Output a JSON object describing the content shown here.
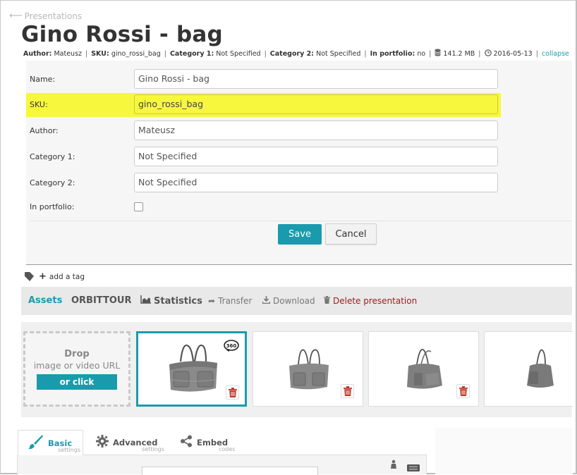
{
  "header": {
    "back_label": "Presentations",
    "title": "Gino Rossi - bag"
  },
  "meta": {
    "author_label": "Author:",
    "author": "Mateusz",
    "sku_label": "SKU:",
    "sku": "gino_rossi_bag",
    "cat1_label": "Category 1:",
    "cat1": "Not Specified",
    "cat2_label": "Category 2:",
    "cat2": "Not Specified",
    "portfolio_label": "In portfolio:",
    "portfolio": "no",
    "size": "141.2 MB",
    "date": "2016-05-13",
    "collapse": "collapse"
  },
  "form": {
    "name_label": "Name:",
    "name_value": "Gino Rossi - bag",
    "sku_label": "SKU:",
    "sku_value": "gino_rossi_bag",
    "author_label": "Author:",
    "author_value": "Mateusz",
    "cat1_label": "Category 1:",
    "cat1_value": "Not Specified",
    "cat2_label": "Category 2:",
    "cat2_value": "Not Specified",
    "portfolio_label": "In portfolio:",
    "portfolio_checked": false,
    "save": "Save",
    "cancel": "Cancel",
    "highlight_color": "#f7f73d"
  },
  "tags": {
    "add_label": "add a tag"
  },
  "tabs": {
    "assets": "Assets",
    "orbittour": "ORBITTOUR",
    "statistics": "Statistics",
    "transfer": "Transfer",
    "download": "Download",
    "delete": "Delete presentation"
  },
  "drop": {
    "line1": "Drop",
    "line2": "image or video URL",
    "button": "or click"
  },
  "thumbnails": [
    {
      "selected": true,
      "badge": "360"
    },
    {
      "selected": false
    },
    {
      "selected": false
    },
    {
      "selected": false
    }
  ],
  "settings_tabs": [
    {
      "title": "Basic",
      "sub": "settings",
      "icon": "brush-icon"
    },
    {
      "title": "Advanced",
      "sub": "settings",
      "icon": "gear-icon"
    },
    {
      "title": "Embed",
      "sub": "codes",
      "icon": "share-icon"
    }
  ],
  "colors": {
    "accent": "#1a9bad",
    "danger": "#9b1c1c",
    "trash": "#c0392b"
  }
}
